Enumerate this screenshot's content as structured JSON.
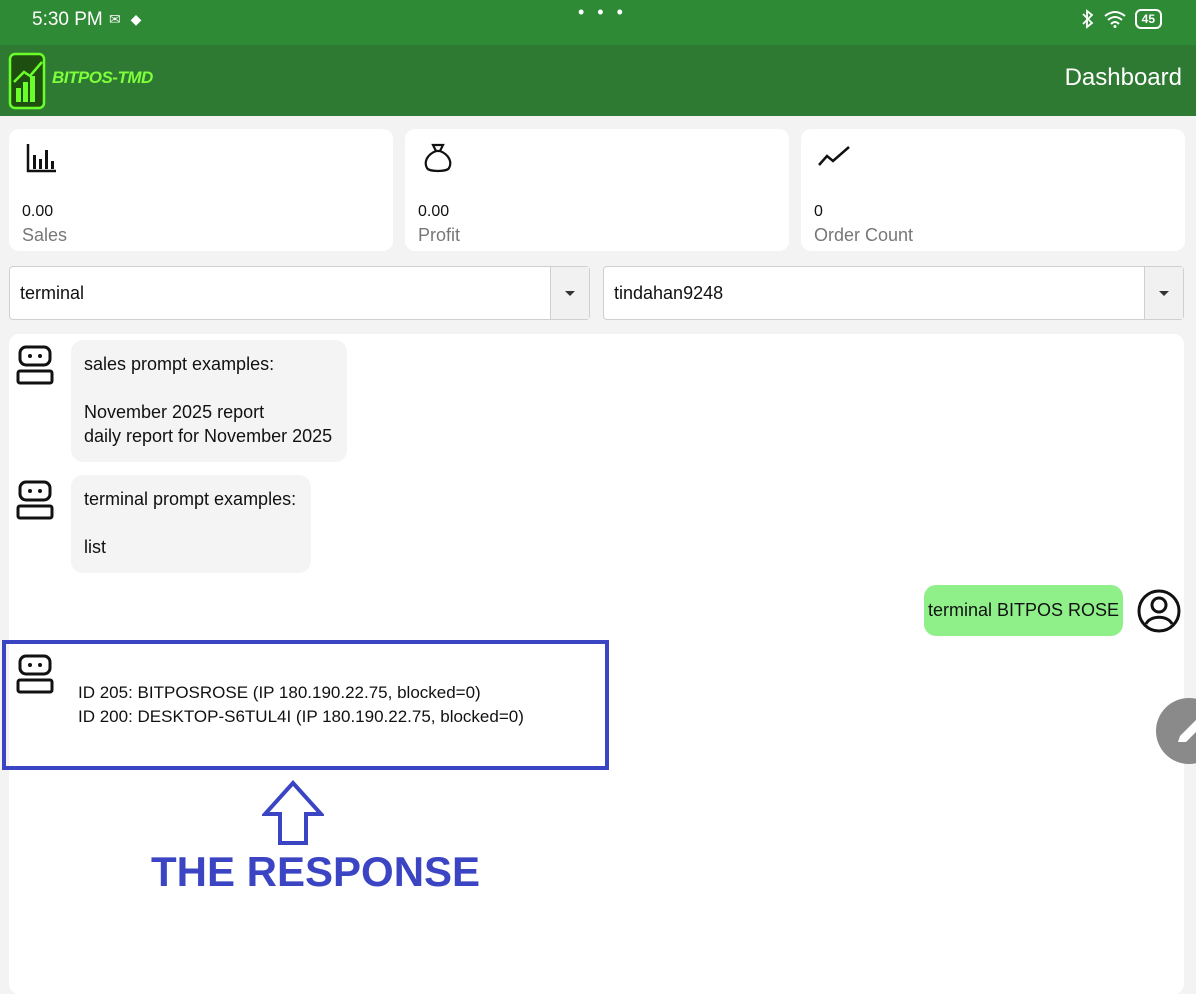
{
  "status_bar": {
    "time": "5:30 PM",
    "battery": "45"
  },
  "app": {
    "logo_text": "BITPOS-TMD",
    "title": "Dashboard"
  },
  "cards": [
    {
      "icon": "bar-chart-icon",
      "value": "0.00",
      "label": "Sales"
    },
    {
      "icon": "money-bag-icon",
      "value": "0.00",
      "label": "Profit"
    },
    {
      "icon": "trend-line-icon",
      "value": "0",
      "label": "Order Count"
    }
  ],
  "selects": {
    "mode": "terminal",
    "store": "tindahan9248"
  },
  "chat": {
    "messages": [
      {
        "role": "bot",
        "text": "sales prompt examples:\n\nNovember 2025 report\ndaily report for November 2025"
      },
      {
        "role": "bot",
        "text": "terminal prompt examples:\n\nlist"
      },
      {
        "role": "user",
        "text": "terminal BITPOS ROSE"
      },
      {
        "role": "bot",
        "text": "ID 205: BITPOSROSE (IP 180.190.22.75, blocked=0)\nID 200: DESKTOP-S6TUL4I (IP 180.190.22.75, blocked=0)"
      }
    ]
  },
  "annotation": {
    "label": "THE RESPONSE",
    "color": "#3b45c3"
  },
  "colors": {
    "status_bar": "#2f8a36",
    "app_bar": "#2e7a32",
    "user_bubble": "#8ff08a",
    "bot_bubble": "#f4f4f4"
  }
}
